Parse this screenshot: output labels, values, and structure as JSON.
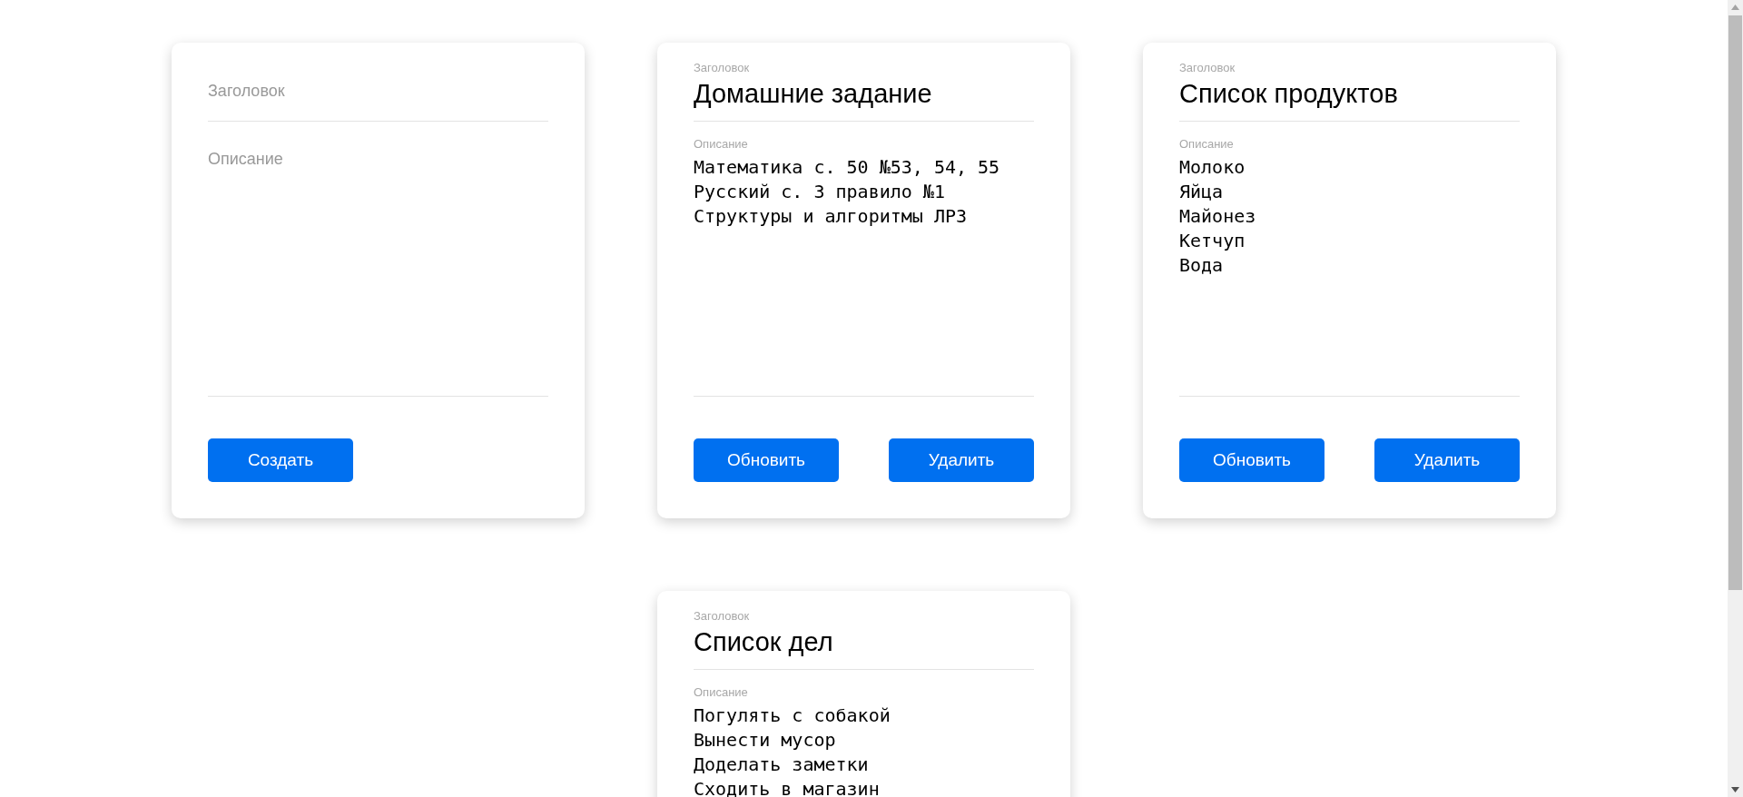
{
  "cards": [
    {
      "kind": "create",
      "title_placeholder": "Заголовок",
      "description_placeholder": "Описание",
      "buttons": [
        "Создать"
      ]
    },
    {
      "kind": "note",
      "title_label": "Заголовок",
      "title": "Домашние задание",
      "description_label": "Описание",
      "description": "Математика с. 50 №53, 54, 55\nРусский с. 3 правило №1\nСтруктуры и алгоритмы ЛР3",
      "buttons": [
        "Обновить",
        "Удалить"
      ]
    },
    {
      "kind": "note",
      "title_label": "Заголовок",
      "title": "Список продуктов",
      "description_label": "Описание",
      "description": "Молоко\nЯйца\nМайонез\nКетчуп\nВода",
      "buttons": [
        "Обновить",
        "Удалить"
      ]
    },
    {
      "kind": "note",
      "title_label": "Заголовок",
      "title": "Список дел",
      "description_label": "Описание",
      "description": "Погулять с собакой\nВынести мусор\nДоделать заметки\nСходить в магазин"
    }
  ]
}
